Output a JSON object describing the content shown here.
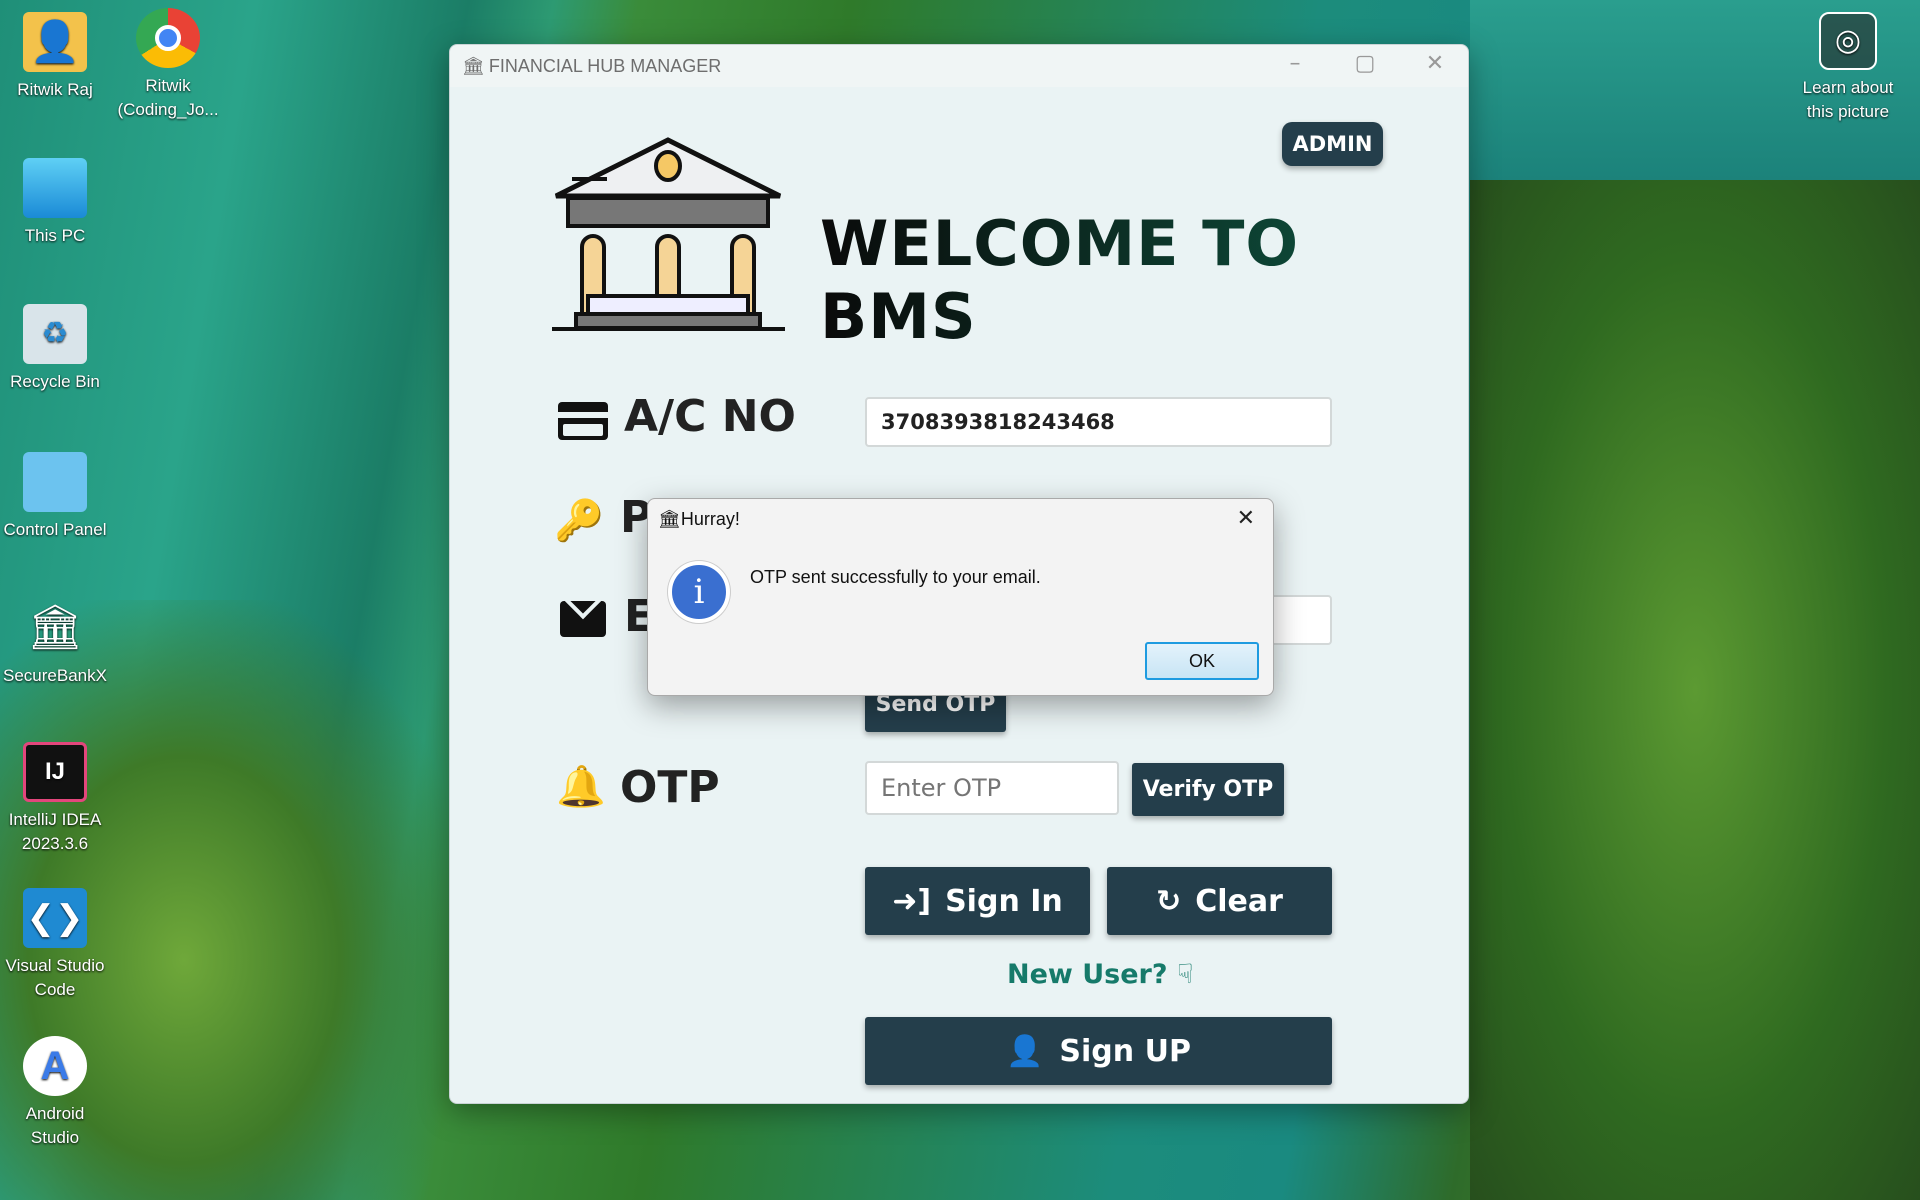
{
  "desktop": {
    "icons": [
      {
        "label": "Ritwik Raj",
        "icon": "folder-user-icon"
      },
      {
        "label": "Ritwik (Coding_Jo...",
        "icon": "chrome-icon"
      },
      {
        "label": "This PC",
        "icon": "monitor-icon"
      },
      {
        "label": "Recycle Bin",
        "icon": "recycle-bin-icon"
      },
      {
        "label": "Control Panel",
        "icon": "control-panel-icon"
      },
      {
        "label": "SecureBankX",
        "icon": "bank-icon"
      },
      {
        "label": "IntelliJ IDEA 2023.3.6",
        "icon": "intellij-icon"
      },
      {
        "label": "Visual Studio Code",
        "icon": "vscode-icon"
      },
      {
        "label": "Android Studio",
        "icon": "android-studio-icon"
      }
    ],
    "learn_about": "Learn about this picture"
  },
  "window": {
    "title": "FINANCIAL HUB MANAGER",
    "admin": "ADMIN",
    "welcome": "WELCOME TO BMS",
    "acno_label": "A/C NO",
    "acno_value": "3708393818243468",
    "password_label": "P",
    "email_label": "E",
    "send_otp": "Send OTP",
    "otp_label": "OTP",
    "otp_placeholder": "Enter OTP",
    "verify_otp": "Verify OTP",
    "sign_in": "Sign In",
    "clear": "Clear",
    "new_user": "New User?",
    "sign_up": "Sign UP",
    "colors": {
      "button": "#243e4b",
      "title_green": "#0e5b45",
      "new_user": "#167a6a"
    }
  },
  "dialog": {
    "title": "Hurray!",
    "message": "OTP sent successfully to your email.",
    "ok": "OK",
    "icon": "info-icon"
  }
}
